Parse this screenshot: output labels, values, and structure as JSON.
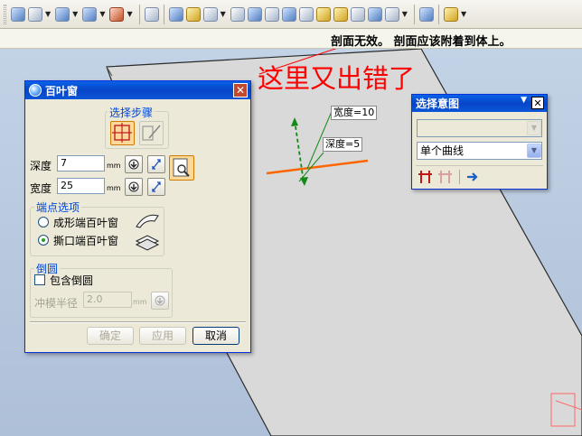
{
  "status": {
    "message": "剖面无效。 剖面应该附着到体上。"
  },
  "annotation": {
    "text": "这里又出错了"
  },
  "viewport": {
    "dimension_width": "宽度=10",
    "dimension_depth": "深度=5"
  },
  "louver_dialog": {
    "title": "百叶窗",
    "steps_label": "选择步骤",
    "depth_label": "深度",
    "depth_value": "7",
    "depth_unit": "mm",
    "width_label": "宽度",
    "width_value": "25",
    "width_unit": "mm",
    "endpoint_group_label": "端点选项",
    "option_formed": "成形端百叶窗",
    "option_lanced": "撕口端百叶窗",
    "selected_option": "撕口端百叶窗",
    "fillet_group_label": "倒圆",
    "include_fillet_label": "包含倒圆",
    "include_fillet_checked": false,
    "punch_radius_label": "冲模半径",
    "punch_radius_value": "2.0",
    "punch_radius_unit": "mm",
    "ok_label": "确定",
    "apply_label": "应用",
    "cancel_label": "取消"
  },
  "intent_dialog": {
    "title": "选择意图",
    "combo1_value": "",
    "combo2_value": "单个曲线"
  },
  "colors": {
    "titlebar": "#0a56d8",
    "dialog_bg": "#ece9d8",
    "annotation": "#ff0000",
    "sketch_line": "#ff6600",
    "dimension": "#138a13"
  }
}
